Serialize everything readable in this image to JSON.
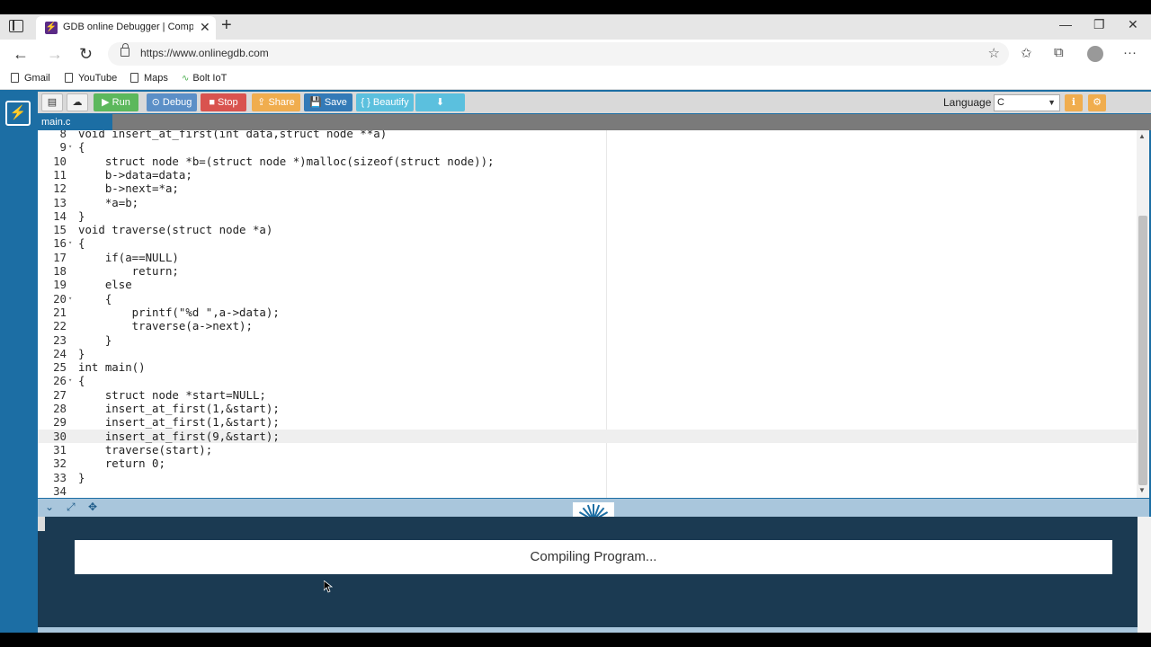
{
  "browser": {
    "tab_title": "GDB online Debugger | Compiler",
    "tab_close": "✕",
    "new_tab": "+",
    "url": "https://www.onlinegdb.com",
    "bookmarks": [
      "Gmail",
      "YouTube",
      "Maps",
      "Bolt IoT"
    ]
  },
  "toolbar": {
    "run": "▶ Run",
    "debug": "⊙ Debug",
    "stop": "■ Stop",
    "share": "⇪ Share",
    "save": "💾 Save",
    "beautify": "{ } Beautify",
    "download": "⬇",
    "language_label": "Language",
    "language_value": "C"
  },
  "colors": {
    "run": "#5cb85c",
    "debug": "#5b8fc7",
    "stop": "#d9534f",
    "share": "#f0ad4e",
    "save": "#337ab7",
    "beautify": "#5bc0de",
    "download": "#5bc0de"
  },
  "editor": {
    "file_tab": "main.c",
    "active_line": 30,
    "lines": [
      {
        "n": "8",
        "fold": "",
        "text": "void insert_at_first(int data,struct node **a)"
      },
      {
        "n": "9",
        "fold": "▾",
        "text": "{"
      },
      {
        "n": "10",
        "fold": "",
        "text": "    struct node *b=(struct node *)malloc(sizeof(struct node));"
      },
      {
        "n": "11",
        "fold": "",
        "text": "    b->data=data;"
      },
      {
        "n": "12",
        "fold": "",
        "text": "    b->next=*a;"
      },
      {
        "n": "13",
        "fold": "",
        "text": "    *a=b;"
      },
      {
        "n": "14",
        "fold": "",
        "text": "}"
      },
      {
        "n": "15",
        "fold": "",
        "text": "void traverse(struct node *a)"
      },
      {
        "n": "16",
        "fold": "▾",
        "text": "{"
      },
      {
        "n": "17",
        "fold": "",
        "text": "    if(a==NULL)"
      },
      {
        "n": "18",
        "fold": "",
        "text": "        return;"
      },
      {
        "n": "19",
        "fold": "",
        "text": "    else"
      },
      {
        "n": "20",
        "fold": "▾",
        "text": "    {"
      },
      {
        "n": "21",
        "fold": "",
        "text": "        printf(\"%d \",a->data);"
      },
      {
        "n": "22",
        "fold": "",
        "text": "        traverse(a->next);"
      },
      {
        "n": "23",
        "fold": "",
        "text": "    }"
      },
      {
        "n": "24",
        "fold": "",
        "text": "}"
      },
      {
        "n": "25",
        "fold": "",
        "text": "int main()"
      },
      {
        "n": "26",
        "fold": "▾",
        "text": "{"
      },
      {
        "n": "27",
        "fold": "",
        "text": "    struct node *start=NULL;"
      },
      {
        "n": "28",
        "fold": "",
        "text": "    insert_at_first(1,&start);"
      },
      {
        "n": "29",
        "fold": "",
        "text": "    insert_at_first(1,&start);"
      },
      {
        "n": "30",
        "fold": "",
        "text": "    insert_at_first(9,&start);"
      },
      {
        "n": "31",
        "fold": "",
        "text": "    traverse(start);"
      },
      {
        "n": "32",
        "fold": "",
        "text": "    return 0;"
      },
      {
        "n": "33",
        "fold": "",
        "text": "}"
      },
      {
        "n": "34",
        "fold": "",
        "text": ""
      }
    ]
  },
  "console": {
    "status": "Compiling Program..."
  }
}
